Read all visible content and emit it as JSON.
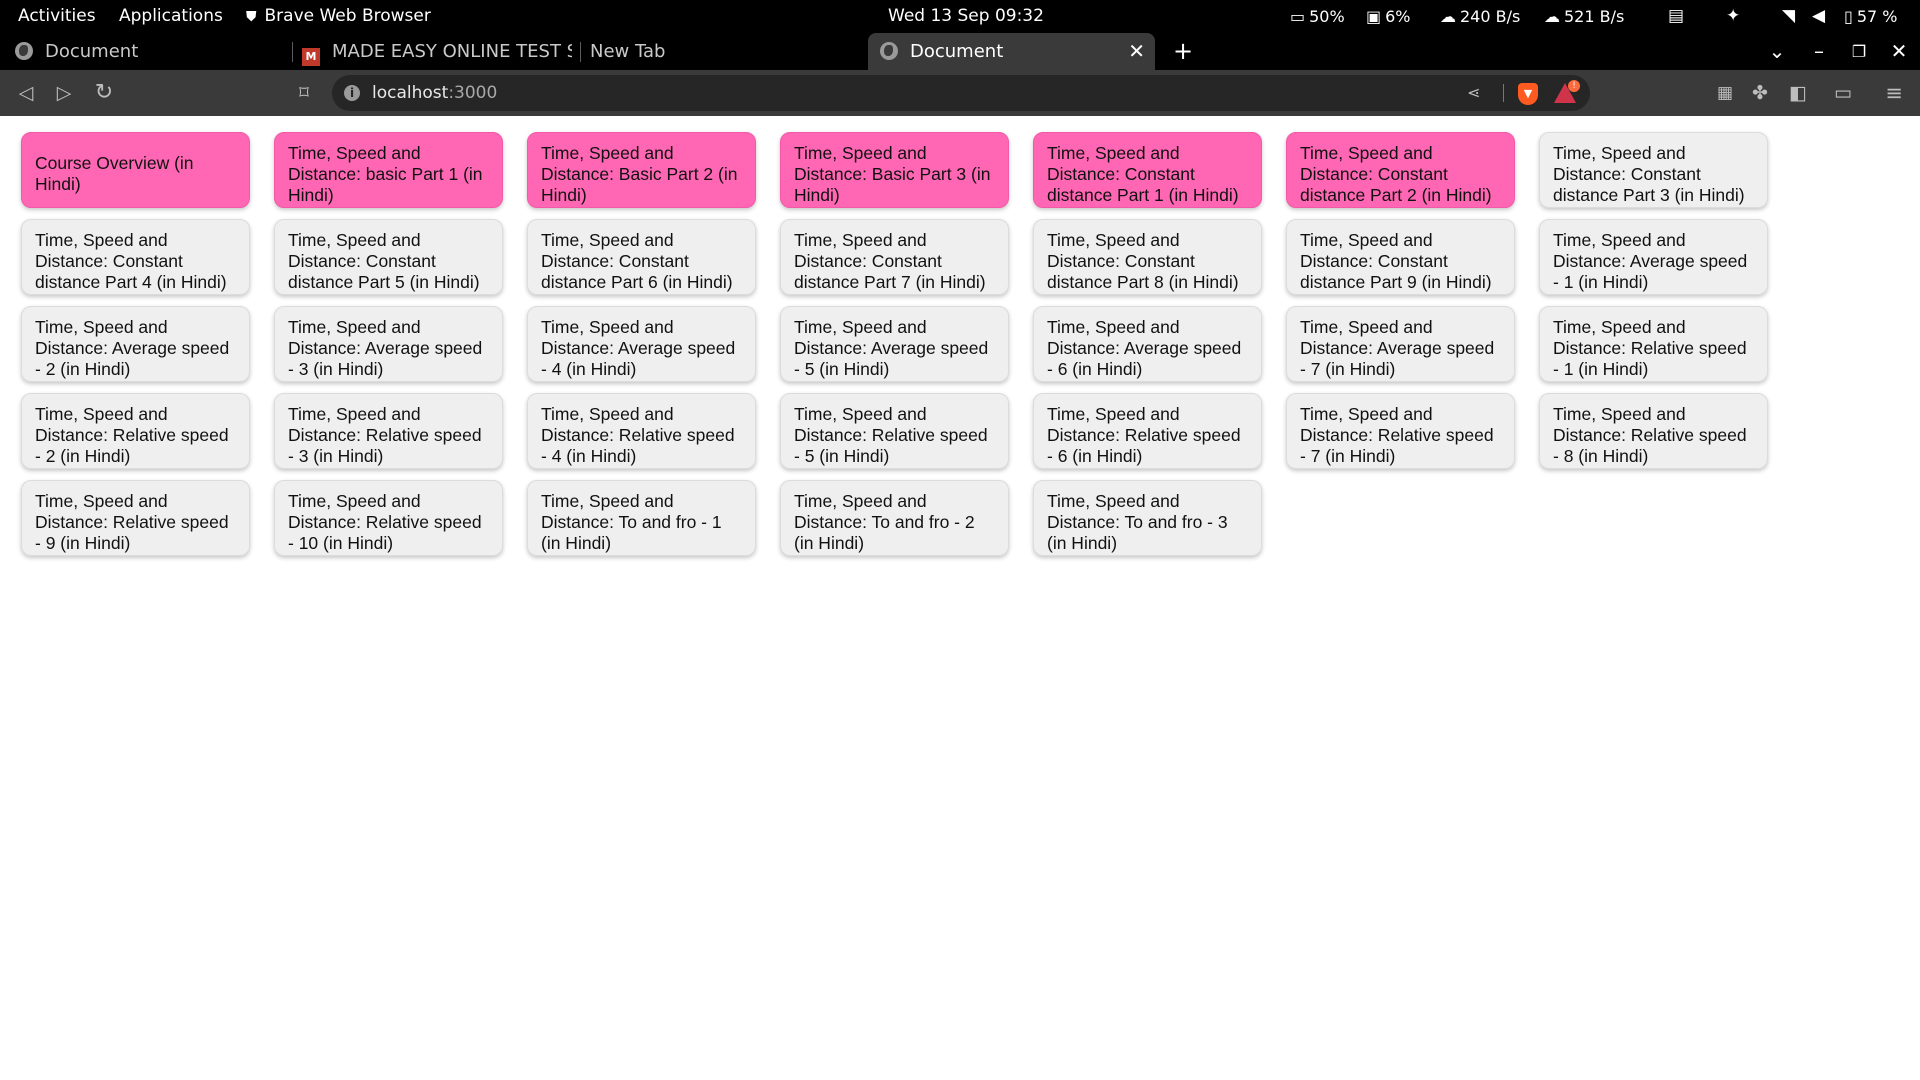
{
  "system_bar": {
    "activities": "Activities",
    "applications": "Applications",
    "app_name": "Brave Web Browser",
    "clock": "Wed 13 Sep  09:32",
    "cpu": "50%",
    "memory": "6%",
    "download": "240 B/s",
    "upload": "521 B/s",
    "battery": "57 %"
  },
  "tabs": [
    {
      "title": "Document",
      "active": false,
      "icon": "globe-icon"
    },
    {
      "title": "MADE EASY ONLINE TEST SER",
      "active": false,
      "icon": "made-easy-icon"
    },
    {
      "title": "New Tab",
      "active": false,
      "icon": ""
    },
    {
      "title": "Document",
      "active": true,
      "icon": "globe-icon"
    }
  ],
  "address_bar": {
    "host": "localhost",
    "port": ":3000"
  },
  "accent_colors": {
    "completed_card": "#ff66b3",
    "default_card": "#efefef"
  },
  "cards": [
    {
      "label": "Course Overview (in Hindi)",
      "completed": true
    },
    {
      "label": "Time, Speed and Distance: basic Part 1 (in Hindi)",
      "completed": true
    },
    {
      "label": "Time, Speed and Distance: Basic Part 2 (in Hindi)",
      "completed": true
    },
    {
      "label": "Time, Speed and Distance: Basic Part 3 (in Hindi)",
      "completed": true
    },
    {
      "label": "Time, Speed and Distance: Constant distance Part 1 (in Hindi)",
      "completed": true
    },
    {
      "label": "Time, Speed and Distance: Constant distance Part 2 (in Hindi)",
      "completed": true
    },
    {
      "label": "Time, Speed and Distance: Constant distance Part 3 (in Hindi)",
      "completed": false
    },
    {
      "label": "Time, Speed and Distance: Constant distance Part 4 (in Hindi)",
      "completed": false
    },
    {
      "label": "Time, Speed and Distance: Constant distance Part 5 (in Hindi)",
      "completed": false
    },
    {
      "label": "Time, Speed and Distance: Constant distance Part 6 (in Hindi)",
      "completed": false
    },
    {
      "label": "Time, Speed and Distance: Constant distance Part 7 (in Hindi)",
      "completed": false
    },
    {
      "label": "Time, Speed and Distance: Constant distance Part 8 (in Hindi)",
      "completed": false
    },
    {
      "label": "Time, Speed and Distance: Constant distance Part 9 (in Hindi)",
      "completed": false
    },
    {
      "label": "Time, Speed and Distance: Average speed - 1 (in Hindi)",
      "completed": false
    },
    {
      "label": "Time, Speed and Distance: Average speed - 2 (in Hindi)",
      "completed": false
    },
    {
      "label": "Time, Speed and Distance: Average speed - 3 (in Hindi)",
      "completed": false
    },
    {
      "label": "Time, Speed and Distance: Average speed - 4 (in Hindi)",
      "completed": false
    },
    {
      "label": "Time, Speed and Distance: Average speed - 5 (in Hindi)",
      "completed": false
    },
    {
      "label": "Time, Speed and Distance: Average speed - 6 (in Hindi)",
      "completed": false
    },
    {
      "label": "Time, Speed and Distance: Average speed - 7 (in Hindi)",
      "completed": false
    },
    {
      "label": "Time, Speed and Distance: Relative speed - 1 (in Hindi)",
      "completed": false
    },
    {
      "label": "Time, Speed and Distance: Relative speed - 2 (in Hindi)",
      "completed": false
    },
    {
      "label": "Time, Speed and Distance: Relative speed - 3 (in Hindi)",
      "completed": false
    },
    {
      "label": "Time, Speed and Distance: Relative speed - 4 (in Hindi)",
      "completed": false
    },
    {
      "label": "Time, Speed and Distance: Relative speed - 5 (in Hindi)",
      "completed": false
    },
    {
      "label": "Time, Speed and Distance: Relative speed - 6 (in Hindi)",
      "completed": false
    },
    {
      "label": "Time, Speed and Distance: Relative speed - 7 (in Hindi)",
      "completed": false
    },
    {
      "label": "Time, Speed and Distance: Relative speed - 8 (in Hindi)",
      "completed": false
    },
    {
      "label": "Time, Speed and Distance: Relative speed - 9 (in Hindi)",
      "completed": false
    },
    {
      "label": "Time, Speed and Distance: Relative speed - 10 (in Hindi)",
      "completed": false
    },
    {
      "label": "Time, Speed and Distance: To and fro - 1 (in Hindi)",
      "completed": false
    },
    {
      "label": "Time, Speed and Distance: To and fro - 2 (in Hindi)",
      "completed": false
    },
    {
      "label": "Time, Speed and Distance: To and fro - 3 (in Hindi)",
      "completed": false
    }
  ]
}
